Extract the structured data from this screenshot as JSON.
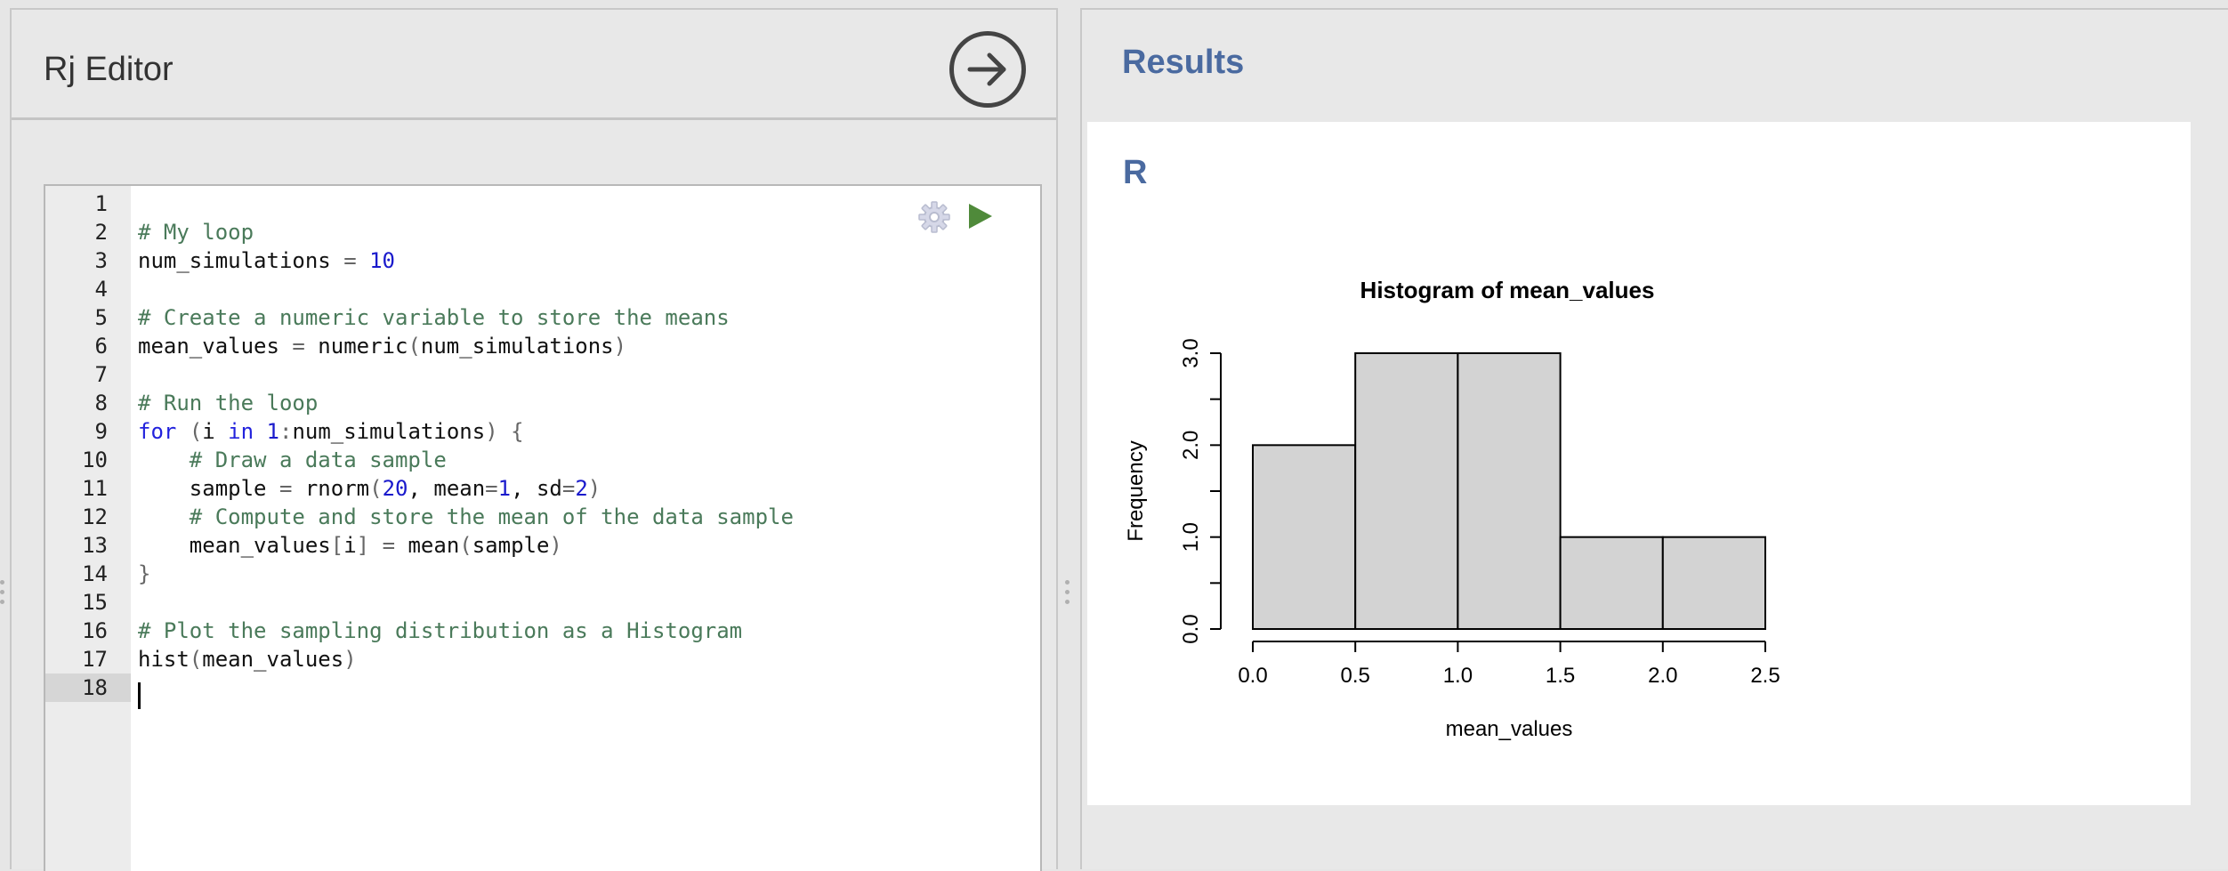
{
  "editor": {
    "title": "Rj Editor",
    "run_icon": "arrow-right-circle-icon",
    "gear_icon": "gear-icon",
    "play_icon": "play-icon",
    "active_line": 18,
    "lines": [
      {
        "n": "1",
        "html": ""
      },
      {
        "n": "2",
        "html": "<span class='c-comment'># My loop</span>"
      },
      {
        "n": "3",
        "html": "num_simulations <span class='c-punct'>=</span> <span class='c-num'>10</span>"
      },
      {
        "n": "4",
        "html": ""
      },
      {
        "n": "5",
        "html": "<span class='c-comment'># Create a numeric variable to store the means</span>"
      },
      {
        "n": "6",
        "html": "mean_values <span class='c-punct'>=</span> numeric<span class='c-punct'>(</span>num_simulations<span class='c-punct'>)</span>"
      },
      {
        "n": "7",
        "html": ""
      },
      {
        "n": "8",
        "html": "<span class='c-comment'># Run the loop</span>"
      },
      {
        "n": "9",
        "html": "<span class='c-kw'>for</span> <span class='c-punct'>(</span>i <span class='c-kw'>in</span> <span class='c-num'>1</span><span class='c-punct'>:</span>num_simulations<span class='c-punct'>)</span> <span class='c-punct'>{</span>"
      },
      {
        "n": "10",
        "html": "    <span class='c-comment'># Draw a data sample</span>"
      },
      {
        "n": "11",
        "html": "    sample <span class='c-punct'>=</span> rnorm<span class='c-punct'>(</span><span class='c-num'>20</span>, mean<span class='c-punct'>=</span><span class='c-num'>1</span>, sd<span class='c-punct'>=</span><span class='c-num'>2</span><span class='c-punct'>)</span>"
      },
      {
        "n": "12",
        "html": "    <span class='c-comment'># Compute and store the mean of the data sample</span>"
      },
      {
        "n": "13",
        "html": "    mean_values<span class='c-punct'>[</span>i<span class='c-punct'>]</span> <span class='c-punct'>=</span> mean<span class='c-punct'>(</span>sample<span class='c-punct'>)</span>"
      },
      {
        "n": "14",
        "html": "<span class='c-punct'>}</span>"
      },
      {
        "n": "15",
        "html": ""
      },
      {
        "n": "16",
        "html": "<span class='c-comment'># Plot the sampling distribution as a Histogram</span>"
      },
      {
        "n": "17",
        "html": "hist<span class='c-punct'>(</span>mean_values<span class='c-punct'>)</span>"
      },
      {
        "n": "18",
        "html": ""
      }
    ]
  },
  "results": {
    "title": "Results",
    "r_label": "R"
  },
  "chart_data": {
    "type": "bar",
    "title": "Histogram of mean_values",
    "xlabel": "mean_values",
    "ylabel": "Frequency",
    "bins": [
      [
        0.0,
        0.5
      ],
      [
        0.5,
        1.0
      ],
      [
        1.0,
        1.5
      ],
      [
        1.5,
        2.0
      ],
      [
        2.0,
        2.5
      ]
    ],
    "values": [
      2,
      3,
      3,
      1,
      1
    ],
    "xticks": [
      "0.0",
      "0.5",
      "1.0",
      "1.5",
      "2.0",
      "2.5"
    ],
    "yticks": [
      "0.0",
      "1.0",
      "2.0",
      "3.0"
    ],
    "xlim": [
      0.0,
      2.5
    ],
    "ylim": [
      0,
      3
    ],
    "bar_color": "#d3d3d3"
  }
}
